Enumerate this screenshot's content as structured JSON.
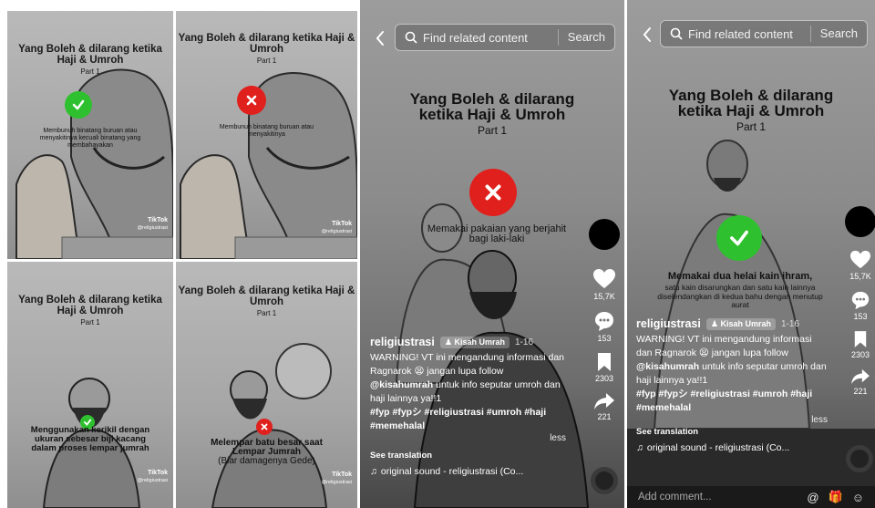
{
  "colors": {
    "check": "#2fc02f",
    "cross": "#e0201d",
    "text_dark": "#111111",
    "overlay_text": "#ffffff"
  },
  "grid": [
    {
      "title": "Yang Boleh & dilarang ketika Haji & Umroh",
      "part": "Part 1",
      "caption": "Membunuh binatang buruan atau menyakitinya kecuali binatang yang membahayakan",
      "caption_paren": "",
      "mark": "check-icon",
      "watermark": "TikTok",
      "watermark_user": "@religiustrasi"
    },
    {
      "title": "Yang Boleh & dilarang ketika Haji & Umroh",
      "part": "Part 1",
      "caption": "Membunuh binatang buruan atau menyakitinya",
      "caption_paren": "",
      "mark": "cross-icon",
      "watermark": "TikTok",
      "watermark_user": "@religiustrasi"
    },
    {
      "title": "Yang Boleh & dilarang ketika Haji & Umroh",
      "part": "Part 1",
      "caption": "Menggunakan kerikil dengan ukuran sebesar biji kacang dalam proses lempar jumrah",
      "caption_paren": "",
      "mark": "check-icon",
      "watermark": "TikTok",
      "watermark_user": "@religiustrasi"
    },
    {
      "title": "Yang Boleh & dilarang ketika Haji & Umroh",
      "part": "Part 1",
      "caption": "Melempar batu besar saat Lempar Jumrah",
      "caption_paren": "(Biar damagenya Gede)",
      "mark": "cross-icon",
      "watermark": "TikTok",
      "watermark_user": "@religiustrasi"
    }
  ],
  "phones": [
    {
      "search_placeholder": "Find related content",
      "search_button": "Search",
      "video_title": "Yang Boleh & dilarang ketika Haji & Umroh",
      "video_part": "Part 1",
      "caption": "Memakai pakaian yang berjahit bagi laki-laki",
      "mark": "cross-icon",
      "likes": "15,7K",
      "comments": "153",
      "saves": "2303",
      "shares": "221",
      "username": "religiustrasi",
      "collection": "Kisah Umrah",
      "date": "1-16",
      "desc_1": "WARNING! VT ini mengandung informasi dan Ragnarok 😫 jangan lupa follow ",
      "mention": "@kisahumrah",
      "desc_2": " untuk info seputar umroh dan haji lainnya ya!!1",
      "hashtags": "#fyp #fypシ #religiustrasi #umroh #haji #memehalal",
      "less": "less",
      "see_translation": "See translation",
      "sound": "original sound - religiustrasi (Co...",
      "comment_placeholder": ""
    },
    {
      "search_placeholder": "Find related content",
      "search_button": "Search",
      "video_title": "Yang Boleh & dilarang ketika Haji & Umroh",
      "video_part": "Part 1",
      "caption": "Memakai dua helai kain ihram,",
      "caption_sub": "satu kain disarungkan dan satu kain lainnya diselendangkan di kedua bahu dengan menutup aurat",
      "mark": "check-icon",
      "likes": "15,7K",
      "comments": "153",
      "saves": "2303",
      "shares": "221",
      "username": "religiustrasi",
      "collection": "Kisah Umrah",
      "date": "1-16",
      "desc_1": "WARNING! VT ini mengandung informasi dan Ragnarok 😫 jangan lupa follow ",
      "mention": "@kisahumrah",
      "desc_2": " untuk info seputar umroh dan haji lainnya ya!!1",
      "hashtags": "#fyp #fypシ #religiustrasi #umroh #haji #memehalal",
      "less": "less",
      "see_translation": "See translation",
      "sound": "original sound - religiustrasi (Co...",
      "comment_placeholder": "Add comment..."
    }
  ]
}
